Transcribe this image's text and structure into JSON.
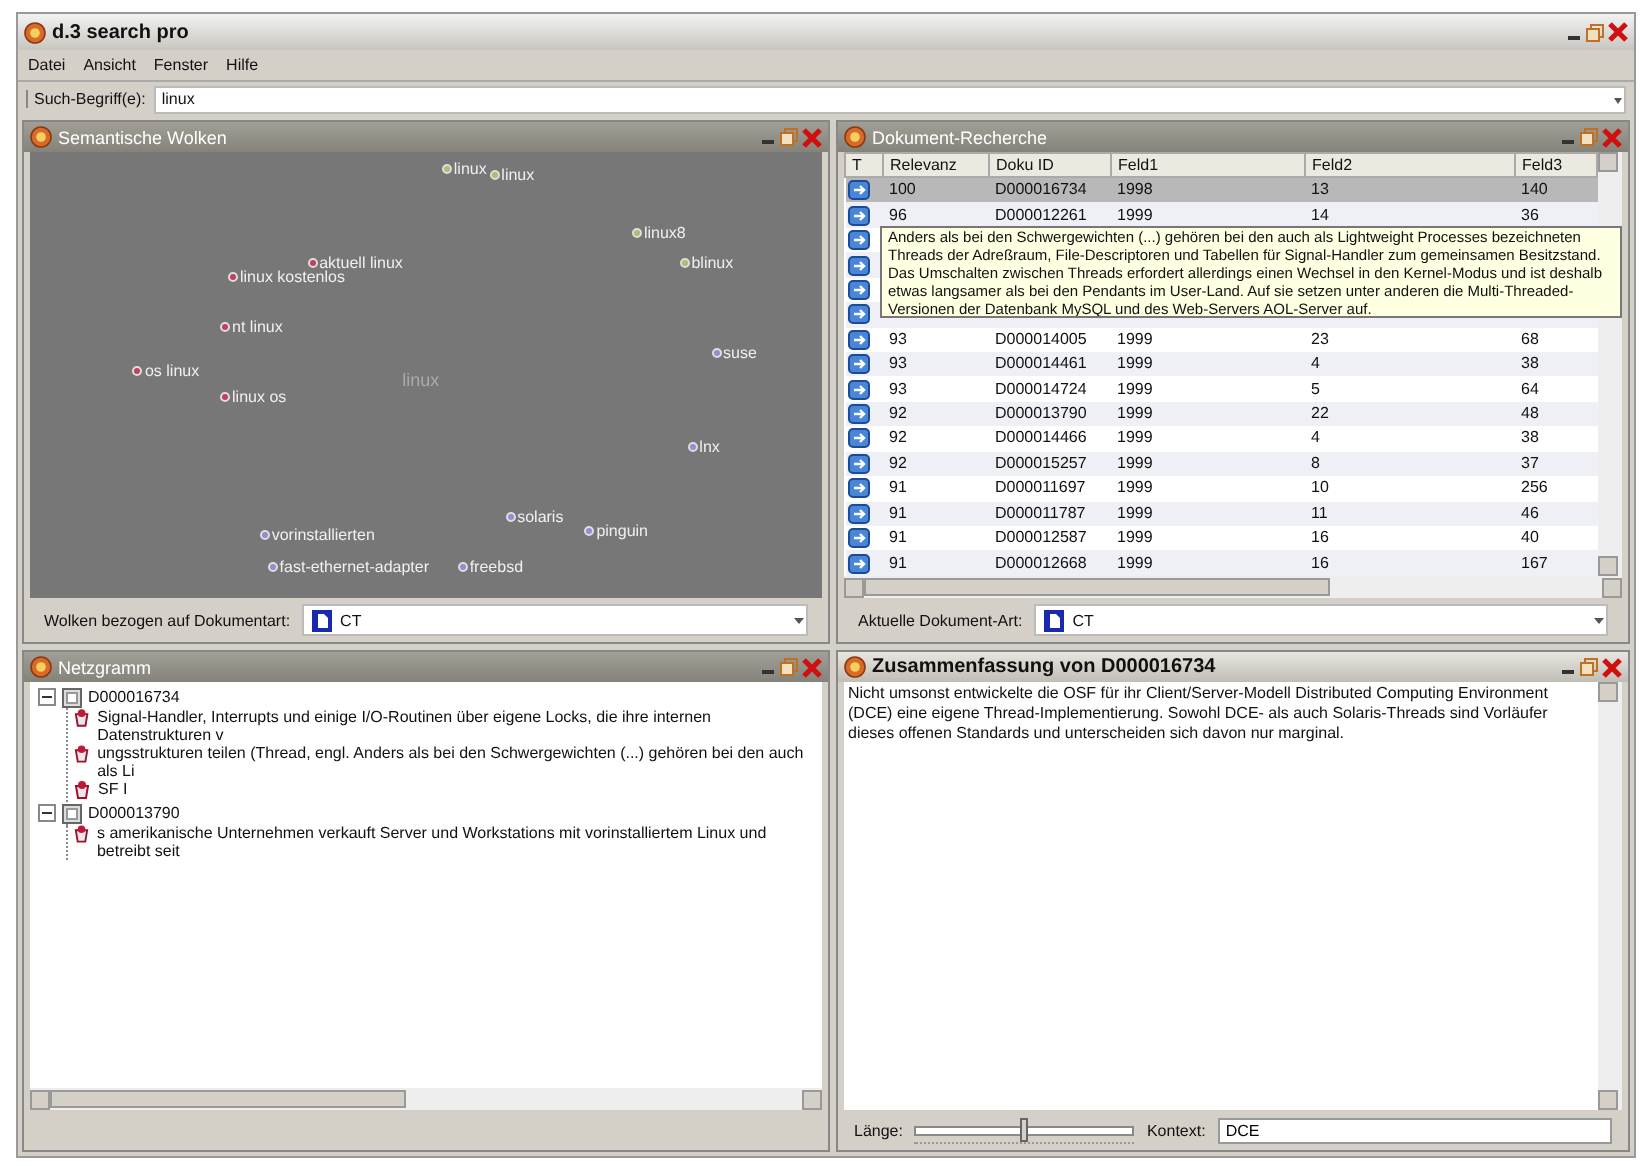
{
  "window": {
    "title": "d.3 search pro"
  },
  "menu": [
    "Datei",
    "Ansicht",
    "Fenster",
    "Hilfe"
  ],
  "search": {
    "label": "Such-Begriff(e):",
    "value": "linux"
  },
  "clouds_panel": {
    "title": "Semantische Wolken",
    "active": false,
    "words": [
      {
        "text": "linux",
        "kind": "term",
        "color": "#a8c070"
      },
      {
        "text": "linux",
        "kind": "term",
        "color": "#a8c070"
      },
      {
        "text": "linux8",
        "kind": "term",
        "color": "#a8c070"
      },
      {
        "text": "blinux",
        "kind": "term",
        "color": "#a8c070"
      },
      {
        "text": "aktuell linux",
        "kind": "term",
        "color": "#c04060"
      },
      {
        "text": "linux kostenlos",
        "kind": "term",
        "color": "#c04060"
      },
      {
        "text": "nt linux",
        "kind": "term",
        "color": "#c04060"
      },
      {
        "text": "os linux",
        "kind": "term",
        "color": "#c04060"
      },
      {
        "text": "linux os",
        "kind": "term",
        "color": "#c04060"
      },
      {
        "text": "linux",
        "kind": "query"
      },
      {
        "text": "suse",
        "kind": "term",
        "color": "#9090d0"
      },
      {
        "text": "lnx",
        "kind": "term",
        "color": "#9090d0"
      },
      {
        "text": "solaris",
        "kind": "term",
        "color": "#9090d0"
      },
      {
        "text": "pinguin",
        "kind": "term",
        "color": "#9090d0"
      },
      {
        "text": "vorinstallierten",
        "kind": "term",
        "color": "#9090d0"
      },
      {
        "text": "fast-ethernet-adapter",
        "kind": "term",
        "color": "#9090d0"
      },
      {
        "text": "freebsd",
        "kind": "term",
        "color": "#9090d0"
      }
    ],
    "footer": {
      "label": "Wolken bezogen auf Dokumentart:",
      "doc_type": "CT"
    }
  },
  "results_panel": {
    "title": "Dokument-Recherche",
    "active": false,
    "columns": [
      "T",
      "Relevanz",
      "Doku ID",
      "Feld1",
      "Feld2",
      "Feld3"
    ],
    "rows": [
      {
        "cells": [
          "100",
          "D000016734",
          "1998",
          "13",
          "140"
        ],
        "selected": true
      },
      {
        "cells": [
          "96",
          "D000012261",
          "1999",
          "14",
          "36"
        ],
        "selected": false
      },
      {
        "selected": false
      },
      {
        "selected": false
      },
      {
        "selected": false
      },
      {
        "selected": false
      },
      {
        "cells": [
          "93",
          "D000014005",
          "1999",
          "23",
          "68"
        ],
        "selected": false
      },
      {
        "cells": [
          "93",
          "D000014461",
          "1999",
          "4",
          "38"
        ],
        "selected": false
      },
      {
        "cells": [
          "93",
          "D000014724",
          "1999",
          "5",
          "64"
        ],
        "selected": false
      },
      {
        "cells": [
          "92",
          "D000013790",
          "1999",
          "22",
          "48"
        ],
        "selected": false
      },
      {
        "cells": [
          "92",
          "D000014466",
          "1999",
          "4",
          "38"
        ],
        "selected": false
      },
      {
        "cells": [
          "92",
          "D000015257",
          "1999",
          "8",
          "37"
        ],
        "selected": false
      },
      {
        "cells": [
          "91",
          "D000011697",
          "1999",
          "10",
          "256"
        ],
        "selected": false
      },
      {
        "cells": [
          "91",
          "D000011787",
          "1999",
          "11",
          "46"
        ],
        "selected": false
      },
      {
        "cells": [
          "91",
          "D000012587",
          "1999",
          "16",
          "40"
        ],
        "selected": false
      },
      {
        "cells": [
          "91",
          "D000012668",
          "1999",
          "16",
          "167"
        ],
        "selected": false
      }
    ],
    "tooltip": "Anders als bei den Schwergewichten (...) gehören bei den auch als Lightweight Processes bezeichneten Threads der Adreßraum, File-Descriptoren und Tabellen für Signal-Handler zum gemeinsamen Besitzstand.  Das Umschalten zwischen Threads erfordert allerdings einen Wechsel in den Kernel-Modus und ist deshalb etwas langsamer als bei den Pendants im User-Land.  Auf sie setzen unter anderen die Multi-Threaded-Versionen der Datenbank MySQL und des Web-Servers AOL-Server auf.",
    "footer": {
      "label": "Aktuelle Dokument-Art:",
      "doc_type": "CT"
    }
  },
  "tree_panel": {
    "title": "Netzgramm",
    "active": false,
    "nodes": [
      {
        "label": "D000016734",
        "expanded": true,
        "children": [
          {
            "label": "Signal-Handler, Interrupts und einige I/O-Routinen über eigene Locks, die ihre internen Datenstrukturen v"
          },
          {
            "label": "ungsstrukturen teilen (Thread, engl. Anders als bei den Schwergewichten (...) gehören bei den auch als Li"
          },
          {
            "label": "SF I"
          }
        ]
      },
      {
        "label": "D000013790",
        "expanded": true,
        "children": [
          {
            "label": "s amerikanische Unternehmen verkauft Server und Workstations mit vorinstalliertem Linux und betreibt seit"
          }
        ]
      }
    ]
  },
  "summary_panel": {
    "title": "Zusammenfassung von D000016734",
    "active": true,
    "text": "Nicht umsonst entwickelte die OSF für ihr Client/Server-Modell Distributed Computing Environment (DCE) eine eigene Thread-Implementierung. Sowohl DCE- als auch Solaris-Threads sind Vorläufer dieses offenen Standards und unterscheiden sich davon nur marginal.",
    "length": {
      "label": "Länge:",
      "level": 0.5
    },
    "context": {
      "label": "Kontext:",
      "value": "DCE"
    }
  }
}
